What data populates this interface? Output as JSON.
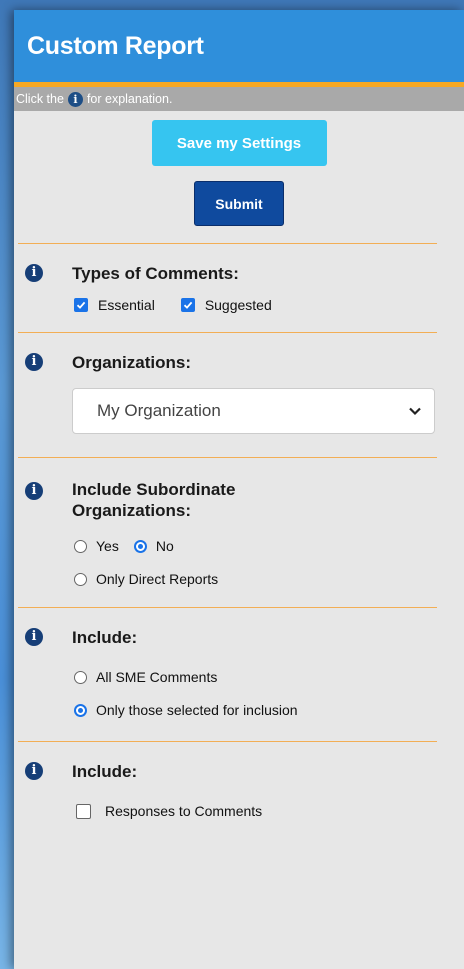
{
  "header": {
    "title": "Custom Report"
  },
  "hint": {
    "prefix": "Click the",
    "suffix": "for explanation."
  },
  "buttons": {
    "save": "Save my Settings",
    "submit": "Submit"
  },
  "sections": {
    "types": {
      "title": "Types of Comments:",
      "options": [
        {
          "label": "Essential",
          "checked": true
        },
        {
          "label": "Suggested",
          "checked": true
        }
      ]
    },
    "organizations": {
      "title": "Organizations:",
      "selected": "My Organization"
    },
    "subordinate": {
      "title_line1": "Include Subordinate",
      "title_line2": "Organizations:",
      "options": [
        {
          "label": "Yes",
          "selected": false
        },
        {
          "label": "No",
          "selected": true
        },
        {
          "label": "Only Direct Reports",
          "selected": false
        }
      ]
    },
    "include1": {
      "title": "Include:",
      "options": [
        {
          "label": "All SME Comments",
          "selected": false
        },
        {
          "label": "Only those selected for inclusion",
          "selected": true
        }
      ]
    },
    "include2": {
      "title": "Include:",
      "options": [
        {
          "label": "Responses to Comments",
          "checked": false
        }
      ]
    }
  },
  "icons": {
    "info": "info-icon",
    "check": "checkmark-icon",
    "dropdown": "chevron-down-icon"
  },
  "colors": {
    "header_bg": "#2f8fdb",
    "accent": "#f7a823",
    "save_btn": "#36c5f0",
    "submit_btn": "#0f4a9e"
  }
}
